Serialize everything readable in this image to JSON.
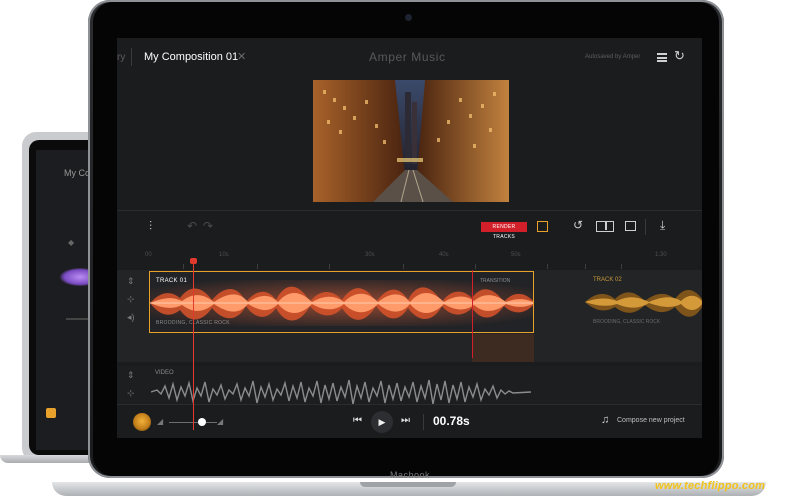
{
  "background_laptop": {
    "title": "My Co",
    "sub_label": "◆"
  },
  "header": {
    "breadcrumb_prev": "ry",
    "composition_title": "My Composition 01",
    "close_glyph": "✕",
    "app_title": "Amper Music",
    "autosave_text": "Autosaved by Amper",
    "menu_icon": "hamburger-icon",
    "history_icon": "undo-history-icon"
  },
  "toolbar": {
    "render_label": "RENDER TRACKS",
    "icons": [
      "mixer-icon",
      "undo-icon",
      "redo-icon",
      "film-icon",
      "loop-icon",
      "split-icon",
      "image-icon",
      "export-icon"
    ]
  },
  "ruler": {
    "labels": [
      "00",
      "10s",
      "",
      "30s",
      "40s",
      "50s",
      "",
      "",
      "",
      "1:30"
    ]
  },
  "tracks": {
    "track1_label": "TRACK 01",
    "track1_tag": "BROODING, CLASSIC ROCK",
    "transition_label": "TRANSITION",
    "track2_label": "TRACK 02",
    "track2_tag": "BROODING, CLASSIC ROCK",
    "video_label": "VIDEO"
  },
  "transport": {
    "time": "00.78s",
    "compose_label": "Compose new project",
    "volume_level": 0.62
  },
  "device": {
    "brand": "Macbook"
  },
  "colors": {
    "accent": "#e8a22c",
    "wave": "#f2673a",
    "render": "#d2202a"
  },
  "watermark": "www.techflippo.com"
}
